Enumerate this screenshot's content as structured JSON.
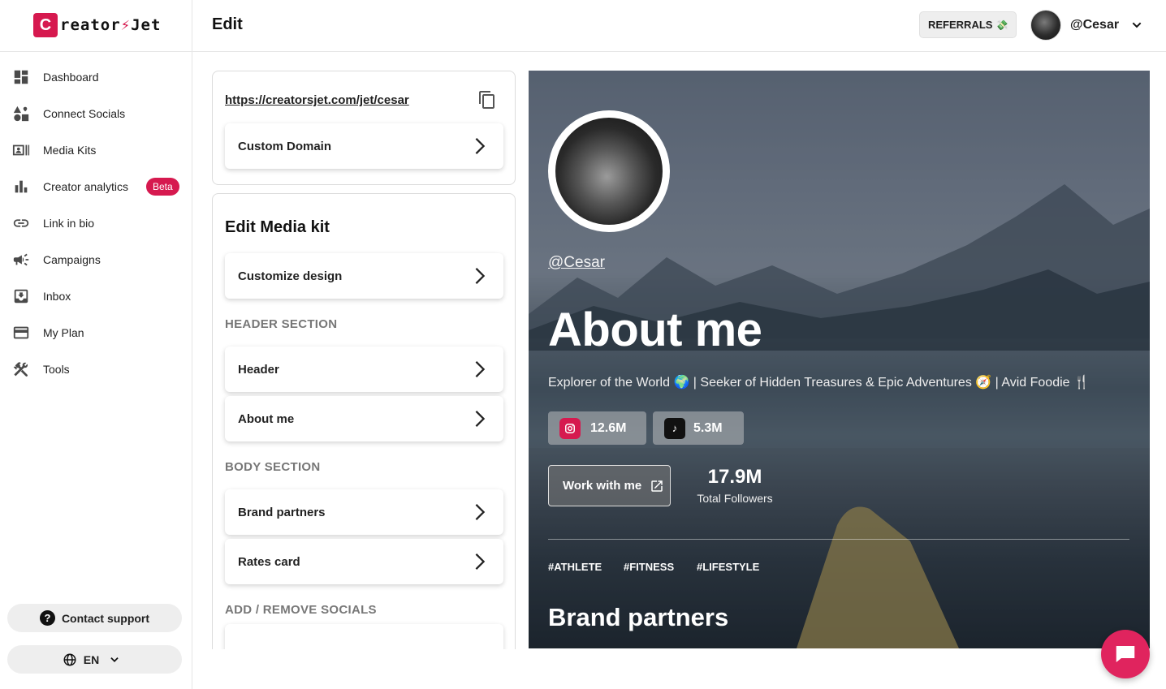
{
  "brand": {
    "logo_letter": "C",
    "logo_text_a": "reator",
    "logo_bolt": "⚡",
    "logo_text_b": "Jet"
  },
  "sidebar": {
    "items": [
      {
        "label": "Dashboard",
        "icon": "dashboard-icon"
      },
      {
        "label": "Connect Socials",
        "icon": "shapes-icon"
      },
      {
        "label": "Media Kits",
        "icon": "media-kit-icon"
      },
      {
        "label": "Creator analytics",
        "icon": "bar-chart-icon",
        "badge": "Beta"
      },
      {
        "label": "Link in bio",
        "icon": "link-icon"
      },
      {
        "label": "Campaigns",
        "icon": "megaphone-icon"
      },
      {
        "label": "Inbox",
        "icon": "inbox-icon"
      },
      {
        "label": "My Plan",
        "icon": "credit-card-icon"
      },
      {
        "label": "Tools",
        "icon": "tools-icon"
      }
    ],
    "support_label": "Contact support",
    "language": "EN"
  },
  "header": {
    "title": "Edit",
    "referrals_label": "REFERRALS",
    "username": "@Cesar"
  },
  "editor": {
    "url": "https://creatorsjet.com/jet/cesar",
    "custom_domain": "Custom Domain",
    "media_kit_title": "Edit Media kit",
    "customize_design": "Customize design",
    "header_section_label": "HEADER SECTION",
    "header_btn": "Header",
    "about_btn": "About me",
    "body_section_label": "BODY SECTION",
    "brand_partners_btn": "Brand partners",
    "rates_card_btn": "Rates card",
    "socials_section_label": "ADD / REMOVE SOCIALS"
  },
  "preview": {
    "handle": "@Cesar",
    "about_title": "About me",
    "bio": "Explorer of the World 🌍 | Seeker of Hidden Treasures & Epic Adventures 🧭 | Avid Foodie 🍴",
    "instagram_followers": "12.6M",
    "tiktok_followers": "5.3M",
    "work_btn": "Work with me",
    "total_followers": "17.9M",
    "total_followers_label": "Total Followers",
    "tags": [
      "#ATHLETE",
      "#FITNESS",
      "#LIFESTYLE"
    ],
    "brand_partners_title": "Brand partners"
  },
  "colors": {
    "accent": "#d6194f",
    "chat": "#e0245e"
  }
}
